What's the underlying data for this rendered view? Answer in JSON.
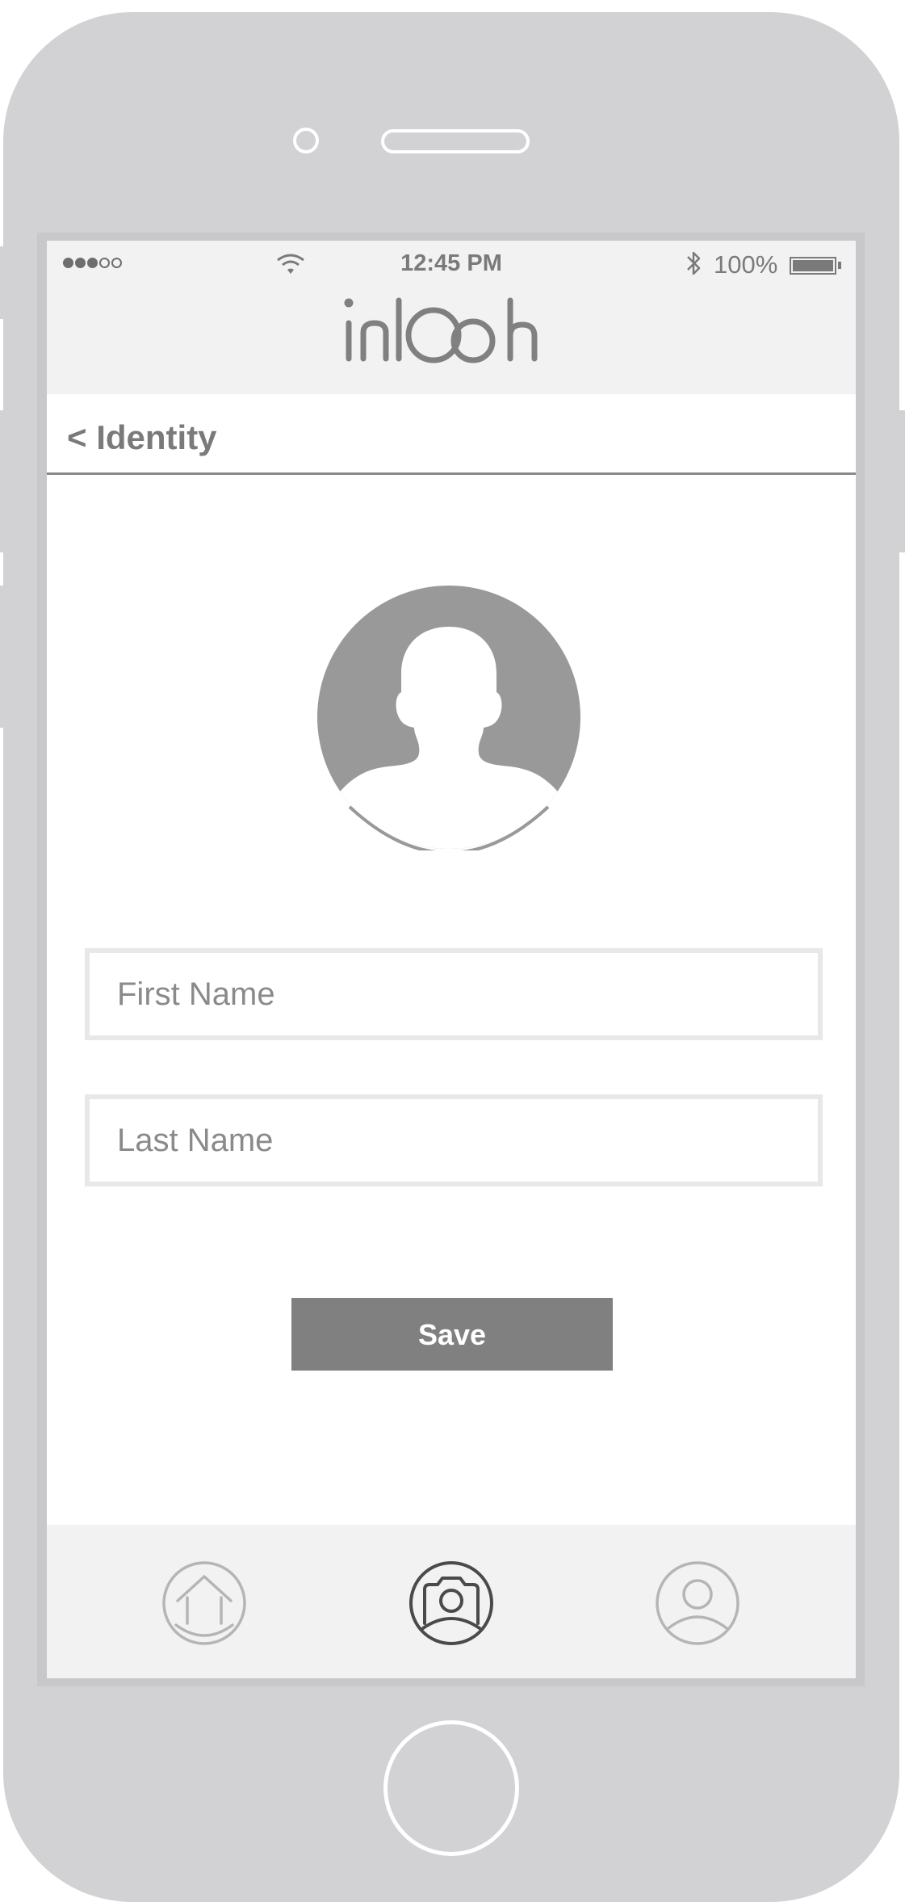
{
  "status_bar": {
    "time": "12:45 PM",
    "battery": "100%",
    "signal_icon": "signal-dots-icon",
    "wifi_icon": "wifi-icon",
    "bluetooth_icon": "bluetooth-icon",
    "battery_icon": "battery-icon"
  },
  "header": {
    "logo_text": "inlooh"
  },
  "nav": {
    "back_label": "< Identity"
  },
  "profile": {
    "avatar_icon": "user-silhouette-icon"
  },
  "form": {
    "first_name": {
      "placeholder": "First Name",
      "value": ""
    },
    "last_name": {
      "placeholder": "Last Name",
      "value": ""
    },
    "save_label": "Save"
  },
  "tabs": [
    {
      "icon": "home-icon",
      "active": false
    },
    {
      "icon": "camera-icon",
      "active": true
    },
    {
      "icon": "profile-icon",
      "active": false
    }
  ],
  "colors": {
    "device": "#d2d2d4",
    "header_bg": "#f2f2f2",
    "text_gray": "#7a7a7a",
    "button_bg": "#808080",
    "avatar": "#999999",
    "tab_inactive": "#b5b5b5",
    "tab_active": "#4a4a4a"
  }
}
